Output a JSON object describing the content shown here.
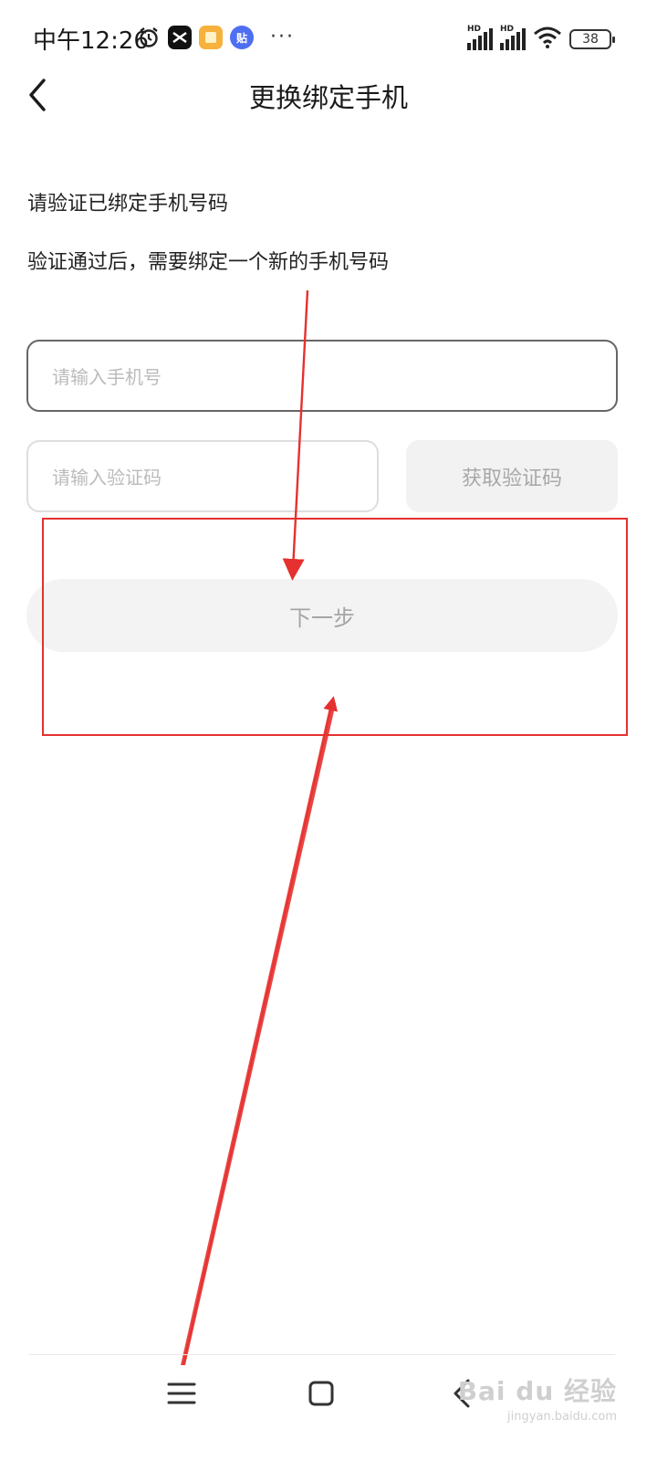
{
  "status_bar": {
    "time": "中午12:26",
    "dots": "···",
    "battery": "38",
    "hd1": "HD",
    "hd2": "HD",
    "tieba_glyph": "贴"
  },
  "header": {
    "title": "更换绑定手机"
  },
  "content": {
    "description_1": "请验证已绑定手机号码",
    "description_2": "验证通过后，需要绑定一个新的手机号码"
  },
  "form": {
    "phone_placeholder": "请输入手机号",
    "code_placeholder": "请输入验证码",
    "get_code_label": "获取验证码",
    "next_label": "下一步"
  },
  "watermark": {
    "logo": "Bai du 经验",
    "url": "jingyan.baidu.com"
  },
  "colors": {
    "annotation": "#e5312f",
    "input_border_active": "#666666",
    "disabled_text": "#a5a5a5"
  }
}
